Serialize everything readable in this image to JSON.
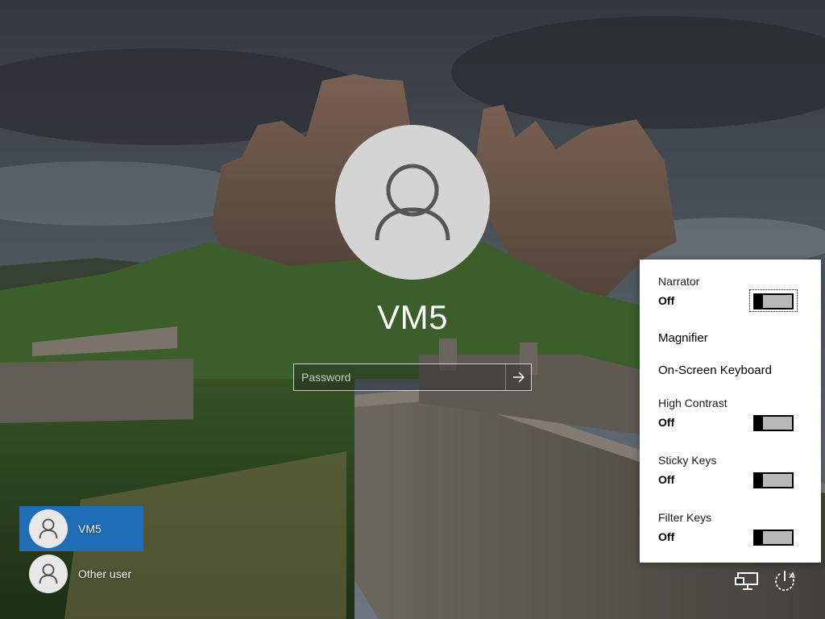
{
  "user": {
    "name": "VM5"
  },
  "password": {
    "placeholder": "Password",
    "value": ""
  },
  "user_list": [
    {
      "label": "VM5",
      "selected": true
    },
    {
      "label": "Other user",
      "selected": false
    }
  ],
  "ease_of_access": {
    "narrator": {
      "label": "Narrator",
      "state": "Off"
    },
    "magnifier": {
      "label": "Magnifier"
    },
    "on_screen_keyboard": {
      "label": "On-Screen Keyboard"
    },
    "high_contrast": {
      "label": "High Contrast",
      "state": "Off"
    },
    "sticky_keys": {
      "label": "Sticky Keys",
      "state": "Off"
    },
    "filter_keys": {
      "label": "Filter Keys",
      "state": "Off"
    }
  },
  "icons": {
    "avatar": "user-silhouette-icon",
    "submit": "arrow-right-icon",
    "network": "network-icon",
    "power": "power-icon"
  },
  "colors": {
    "selected_tile": "#1f6eb6",
    "panel_bg": "#ffffff",
    "toggle_off": "#b8b8b8"
  }
}
